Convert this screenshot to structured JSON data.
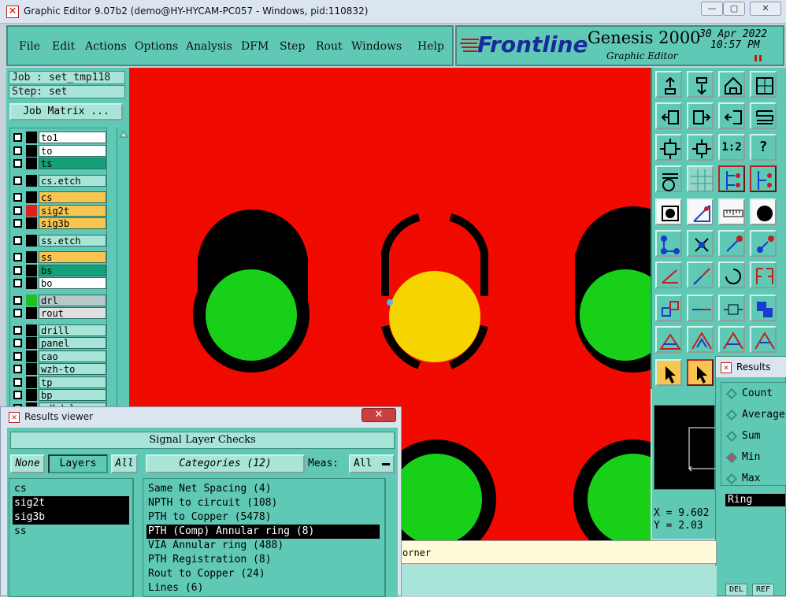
{
  "window": {
    "title": "Graphic Editor 9.07b2 (demo@HY-HYCAM-PC057 - Windows, pid:110832)",
    "minimize": "—",
    "maximize": "▢",
    "close": "✕"
  },
  "menu": {
    "items": [
      "File",
      "Edit",
      "Actions",
      "Options",
      "Analysis",
      "DFM",
      "Step",
      "Rout",
      "Windows",
      "Help"
    ]
  },
  "header": {
    "logo": "Frontline",
    "product": "Genesis 2000",
    "subtitle": "Graphic Editor",
    "date": "30 Apr 2022",
    "time": "10:57 PM"
  },
  "job": {
    "job_label": "Job : set_tmp118",
    "step_label": "Step: set",
    "job_matrix_button": "Job Matrix ..."
  },
  "layers": [
    {
      "name": "to1",
      "color": "#ffffff",
      "swatch": "#000000"
    },
    {
      "name": "to",
      "color": "#ffffff",
      "swatch": "#000000"
    },
    {
      "name": "ts",
      "color": "#14a078",
      "swatch": "#000000"
    },
    {
      "name": "cs.etch",
      "color": "#a8e4d8",
      "swatch": "#000000"
    },
    {
      "name": "cs",
      "color": "#f7c550",
      "swatch": "#000000"
    },
    {
      "name": "sig2t",
      "color": "#f7c550",
      "swatch": "#e02020"
    },
    {
      "name": "sig3b",
      "color": "#f7c550",
      "swatch": "#000000"
    },
    {
      "name": "ss.etch",
      "color": "#a8e4d8",
      "swatch": "#000000"
    },
    {
      "name": "ss",
      "color": "#f7c550",
      "swatch": "#000000"
    },
    {
      "name": "bs",
      "color": "#14a078",
      "swatch": "#000000"
    },
    {
      "name": "bo",
      "color": "#ffffff",
      "swatch": "#000000"
    },
    {
      "name": "drl",
      "color": "#b8c8c8",
      "swatch": "#20c020"
    },
    {
      "name": "rout",
      "color": "#e0e0e0",
      "swatch": "#000000"
    },
    {
      "name": "drill",
      "color": "#a8e4d8",
      "swatch": "#000000"
    },
    {
      "name": "panel",
      "color": "#a8e4d8",
      "swatch": "#000000"
    },
    {
      "name": "cao",
      "color": "#a8e4d8",
      "swatch": "#000000"
    },
    {
      "name": "wzh-to",
      "color": "#a8e4d8",
      "swatch": "#000000"
    },
    {
      "name": "tp",
      "color": "#a8e4d8",
      "swatch": "#000000"
    },
    {
      "name": "bp",
      "color": "#a8e4d8",
      "swatch": "#000000"
    },
    {
      "name": "ydkdrl",
      "color": "#a8e4d8",
      "swatch": "#000000"
    }
  ],
  "tools": {
    "one_to_one": "1:2",
    "help": "?"
  },
  "coords": {
    "x": "X = 9.602",
    "y": "Y = 2.03"
  },
  "results_hist": {
    "title": "Results hist",
    "options": [
      "Count",
      "Average",
      "Sum",
      "Min",
      "Max"
    ],
    "selected": "Min",
    "value": "Ring",
    "del_button": "DEL",
    "ref_button": "REF"
  },
  "message": {
    "text": "orner"
  },
  "results_viewer": {
    "title": "Results viewer",
    "panel_title": "Signal Layer Checks",
    "none_button": "None",
    "layers_label": "Layers",
    "all_button": "All",
    "categories_label": "Categories (12)",
    "meas_label": "Meas:",
    "meas_value": "All",
    "layers": [
      "cs",
      "sig2t",
      "sig3b",
      "ss"
    ],
    "selected_layers": [
      "sig2t",
      "sig3b"
    ],
    "categories": [
      "Same Net Spacing (4)",
      "NPTH to circuit (108)",
      "PTH to Copper (5478)",
      "PTH (Comp) Annular ring (8)",
      "VIA Annular ring (488)",
      "PTH Registration (8)",
      "Rout to Copper (24)",
      "Lines (6)"
    ],
    "selected_category": "PTH (Comp) Annular ring (8)"
  }
}
